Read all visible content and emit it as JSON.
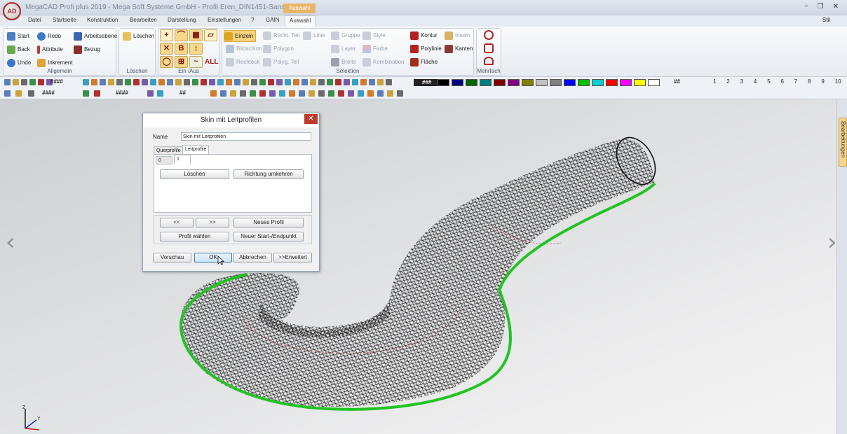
{
  "app": {
    "logo_text": "AD",
    "title": "MegaCAD Profi plus 2019 - Mega Soft Systeme GmbH - Profil Eren_DIN1451-Sans.pvz.prt",
    "context_tab": "Auswahl",
    "window_buttons": {
      "minimize": "−",
      "restore": "❒",
      "close": "✕"
    }
  },
  "menu": {
    "tabs": [
      "Datei",
      "Startseite",
      "Konstruktion",
      "Bearbeiten",
      "Darstellung",
      "Einstellungen",
      "?",
      "GAIN",
      "Auswahl"
    ],
    "active": "Auswahl",
    "style_label": "Stil"
  },
  "ribbon": {
    "allgemein": {
      "label": "Allgemein",
      "buttons": [
        "Start",
        "Redo",
        "Arbeitsebene",
        "Back",
        "Attribute",
        "Bezug",
        "Undo",
        "Inkrement"
      ]
    },
    "loeschen": {
      "label": "Löschen",
      "button": "Löschen"
    },
    "einaus": {
      "label": "Ein /Aus",
      "all_label": "ALL"
    },
    "selektion": {
      "label": "Selektion",
      "buttons": [
        "Einzeln",
        "Recht. Teil",
        "Linie",
        "Gruppe",
        "Style",
        "Kontur",
        "Inseln",
        "Bildschirm",
        "Polygon",
        "Layer",
        "Farbe",
        "Polylinie",
        "Kanten",
        "Rechteck",
        "Polyg. Teil",
        "Breite",
        "Kombination",
        "Fläche"
      ]
    },
    "mehrfach": {
      "label": "Mehrfach"
    }
  },
  "toolbar": {
    "row1_field": "####",
    "row2_fields": [
      "####",
      "####",
      "##"
    ],
    "color_label": "###",
    "layer_hash": "##",
    "layers": [
      "1",
      "2",
      "3",
      "4",
      "5",
      "6",
      "7",
      "8",
      "9",
      "10"
    ],
    "colors": [
      "#000000",
      "#000080",
      "#006400",
      "#007f80",
      "#800000",
      "#800080",
      "#808000",
      "#c0c0c0",
      "#808080",
      "#0000ff",
      "#00c000",
      "#00d0d0",
      "#ff0000",
      "#ff00ff",
      "#ffff00",
      "#ffffff"
    ]
  },
  "side_panel": {
    "tab_label": "Bearbeitungen"
  },
  "viewport": {
    "nav_left": "‹",
    "nav_right": "›",
    "axis_labels": {
      "z": "Z",
      "y": "Y"
    },
    "highlight_color": "#22c322"
  },
  "dialog": {
    "title": "Skin mit Leitprofilen",
    "close": "✕",
    "name_label": "Name",
    "name_value": "Skin mit Leitprofilen",
    "tabs": [
      "Querprofile",
      "Leitprofile"
    ],
    "active_tab": "Leitprofile",
    "subtabs": [
      "0",
      "1"
    ],
    "buttons": {
      "delete": "Löschen",
      "reverse": "Richtung umkehren",
      "prev": "<<",
      "next": ">>",
      "new_profile": "Neues Profil",
      "choose_profile": "Profil wählen",
      "new_start_end": "Neuer Start-/Endpunkt",
      "preview": "Vorschau",
      "ok": "OK",
      "cancel": "Abbrechen",
      "extended": ">>Erweitert"
    }
  }
}
